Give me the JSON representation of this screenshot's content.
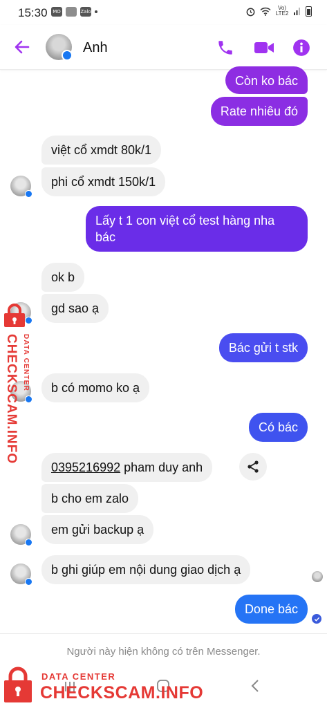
{
  "status_bar": {
    "time": "15:30",
    "app_icons": [
      "MO MO",
      "img",
      "Zalo"
    ],
    "network_label": "Vo) LTE2"
  },
  "header": {
    "contact_name": "Anh",
    "icons": [
      "back-arrow-icon",
      "phone-icon",
      "video-camera-icon",
      "info-icon"
    ]
  },
  "colors": {
    "accent": "#a033f0",
    "bubble_purple": "#8e2de2",
    "bubble_violet": "#6a2de8",
    "bubble_indigo": "#4a4df0",
    "bubble_blue": "#2574f5",
    "incoming": "#f0f0f0",
    "watermark": "#e53935"
  },
  "messages": [
    {
      "side": "out",
      "text": "Còn ko bác"
    },
    {
      "side": "out",
      "text": "Rate nhiêu đó"
    },
    {
      "side": "in",
      "text": "việt cổ xmdt 80k/1"
    },
    {
      "side": "in",
      "text": "phi cổ xmdt 150k/1"
    },
    {
      "side": "out",
      "text": "Lấy t 1 con việt cổ test hàng nha bác"
    },
    {
      "side": "in",
      "text": "ok b"
    },
    {
      "side": "in",
      "text": "gd sao ạ"
    },
    {
      "side": "out",
      "text": "Bác gửi t stk"
    },
    {
      "side": "in",
      "text": "b có momo ko ạ"
    },
    {
      "side": "out",
      "text": "Có bác"
    },
    {
      "side": "in",
      "phone": "0395216992",
      "text": " pham duy anh"
    },
    {
      "side": "in",
      "text": "b cho em zalo"
    },
    {
      "side": "in",
      "text": "em gửi backup ạ"
    },
    {
      "side": "in",
      "text": "b ghi giúp em nội dung giao dịch ạ"
    },
    {
      "side": "out",
      "text": "Done bác"
    }
  ],
  "footer": {
    "notice": "Người này hiện không có trên Messenger."
  },
  "watermark": {
    "line1": "DATA CENTER",
    "line2": "CHECKSCAM.INFO"
  }
}
